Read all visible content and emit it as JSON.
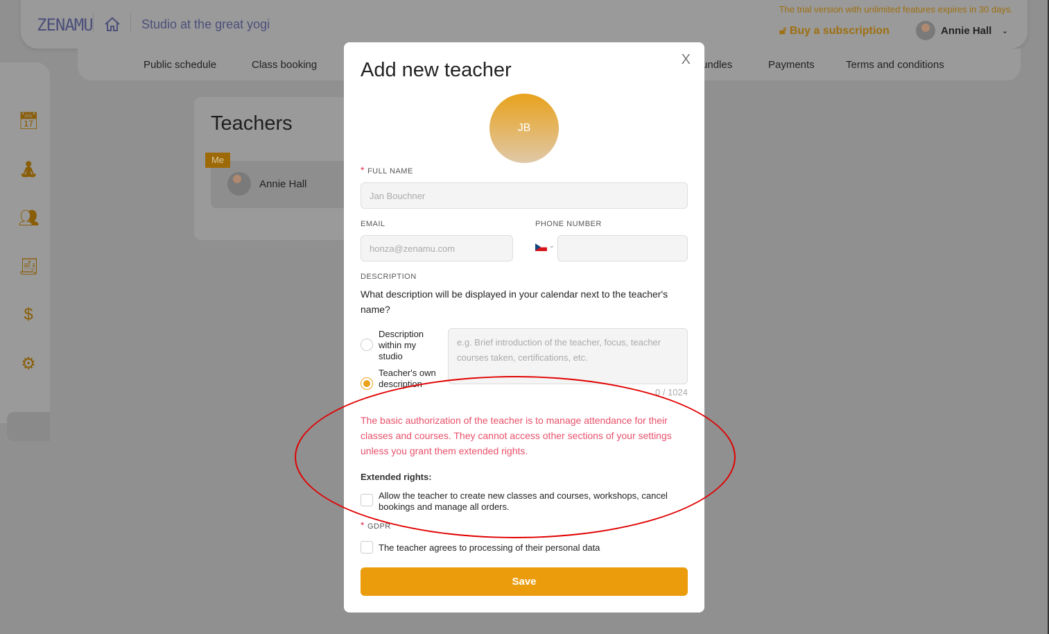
{
  "header": {
    "logo": "ZENAMU",
    "studio": "Studio at the great yogi",
    "trial": "The trial version with unlimited features expires in 30 days.",
    "buy": "Buy a subscription",
    "user": "Annie Hall"
  },
  "nav": [
    "Public schedule",
    "Class booking",
    "Bundles",
    "Payments",
    "Terms and conditions"
  ],
  "sidebar": [
    "calendar-icon",
    "yoga-icon",
    "users-icon",
    "receipt-icon",
    "money-icon",
    "settings-icon"
  ],
  "teachers": {
    "title": "Teachers",
    "me_badge": "Me",
    "name": "Annie Hall"
  },
  "modal": {
    "title": "Add new teacher",
    "close": "X",
    "initials": "JB",
    "full_name_label": "FULL NAME",
    "full_name_placeholder": "Jan Bouchner",
    "email_label": "EMAIL",
    "email_placeholder": "honza@zenamu.com",
    "phone_label": "PHONE NUMBER",
    "phone_country": "CZ",
    "description_label": "DESCRIPTION",
    "description_question": "What description will be displayed in your calendar next to the teacher's name?",
    "radio_studio": "Description within my studio",
    "radio_own": "Teacher's own description",
    "selected": "own",
    "description_placeholder": "e.g. Brief introduction of the teacher, focus, teacher courses taken, certifications, etc.",
    "counter": "0 / 1024",
    "warning": "The basic authorization of the teacher is to manage attendance for their classes and courses. They cannot access other sections of your settings unless you grant them extended rights.",
    "extended_label": "Extended rights:",
    "extended_option": "Allow the teacher to create new classes and courses, workshops, cancel bookings and manage all orders.",
    "extended_checked": false,
    "gdpr_label": "GDPR",
    "gdpr_option": "The teacher agrees to processing of their personal data",
    "gdpr_checked": false,
    "save": "Save"
  },
  "colors": {
    "accent": "#eb9c0c",
    "warning": "#e8506a",
    "annotation": "#e10000"
  }
}
